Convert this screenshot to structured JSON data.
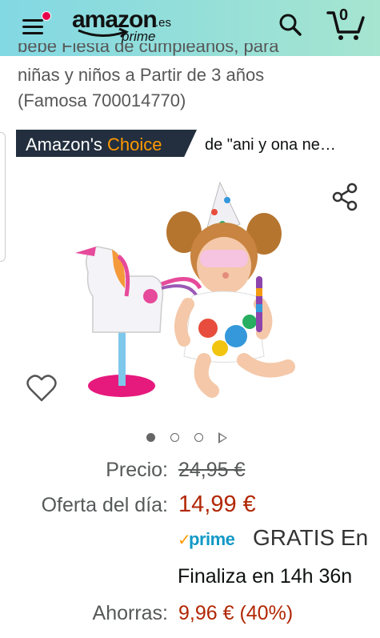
{
  "header": {
    "logo_word": "amazon",
    "logo_tld": ".es",
    "logo_prime": "prime",
    "cart_count": "0",
    "colors": {
      "gradient_start": "#82d8e3",
      "gradient_end": "#a6e5d0",
      "menu_badge": "#e6004c"
    }
  },
  "product": {
    "title_line1": "bebé Fiesta de cumpleaños, para",
    "title_line2": "niñas y niños a Partir de 3 años",
    "title_line3": "(Famosa 700014770)"
  },
  "badge": {
    "amazons": "Amazon's",
    "choice": "Choice",
    "category": "de \"ani y ona ne…",
    "colors": {
      "background": "#232f3e",
      "choice": "#ff9900"
    }
  },
  "gallery": {
    "image_icon": "product-image",
    "total_images": 3,
    "active_index": 0,
    "has_video": true
  },
  "pricing": {
    "list_label": "Precio:",
    "list_price": "24,95 €",
    "deal_label": "Oferta del día:",
    "deal_price": "14,99 €",
    "prime_check": "✓",
    "prime_word": "prime",
    "shipping": "GRATIS En",
    "ends_text": "Finaliza en 14h 36n",
    "savings_label": "Ahorras:",
    "savings_value": "9,96 € (40%)",
    "colors": {
      "deal": "#b12704",
      "prime": "#1399c6"
    }
  }
}
